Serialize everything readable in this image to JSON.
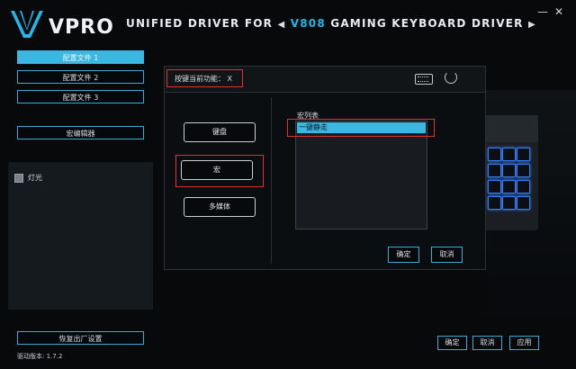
{
  "header": {
    "title_pre": "UNIFIED DRIVER FOR",
    "title_model": "V808",
    "title_post": "GAMING KEYBOARD DRIVER",
    "arrow_left": "◀",
    "arrow_right": "▶",
    "minimize": "—",
    "close": "✕"
  },
  "sidebar": {
    "profiles": [
      "配置文件 1",
      "配置文件 2",
      "配置文件 3"
    ],
    "active_profile": 0,
    "macro_editor": "宏编辑器",
    "light_label": "灯光",
    "reset_label": "恢复出厂设置",
    "version": "驱动版本: 1.7.2"
  },
  "footer_buttons": {
    "ok": "确定",
    "cancel": "取消",
    "apply": "应用"
  },
  "dialog": {
    "current_function": "按键当前功能：  X",
    "func_buttons": [
      "键盘",
      "宏",
      "多媒体"
    ],
    "selected_func": 1,
    "macro_list_label": "宏列表",
    "macro_items": [
      "一键静走"
    ],
    "ok": "确定",
    "cancel": "取消"
  },
  "colors": {
    "accent": "#3bb7e2",
    "highlight_red": "#e03030",
    "key_glow": "#2f7fff"
  }
}
